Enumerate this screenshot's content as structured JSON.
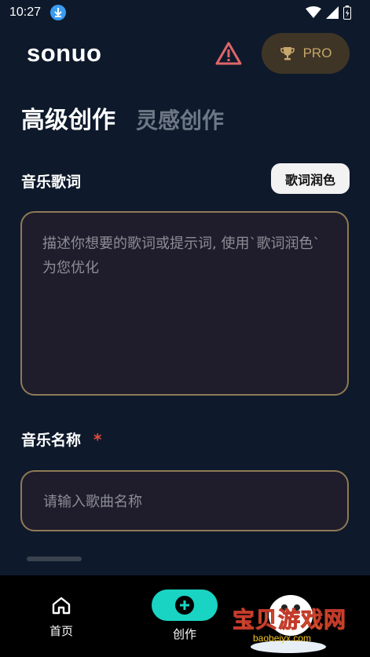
{
  "status": {
    "time": "10:27"
  },
  "app": {
    "logo": "sonuo",
    "pro_label": "PRO"
  },
  "tabs": [
    {
      "label": "高级创作",
      "active": true
    },
    {
      "label": "灵感创作",
      "active": false
    }
  ],
  "lyrics": {
    "label": "音乐歌词",
    "polish_button": "歌词润色",
    "placeholder": "描述你想要的歌词或提示词, 使用`歌词润色`为您优化"
  },
  "music_name": {
    "label": "音乐名称",
    "required_mark": "*",
    "placeholder": "请输入歌曲名称"
  },
  "nav": {
    "home": "首页",
    "create": "创作"
  },
  "watermark": {
    "title": "宝贝游戏网",
    "url": "baobeiyx.com"
  },
  "colors": {
    "background": "#0e1a2b",
    "accent_teal": "#19d4c2",
    "gold_border": "#8f7a55",
    "warning_red": "#e0656a"
  }
}
